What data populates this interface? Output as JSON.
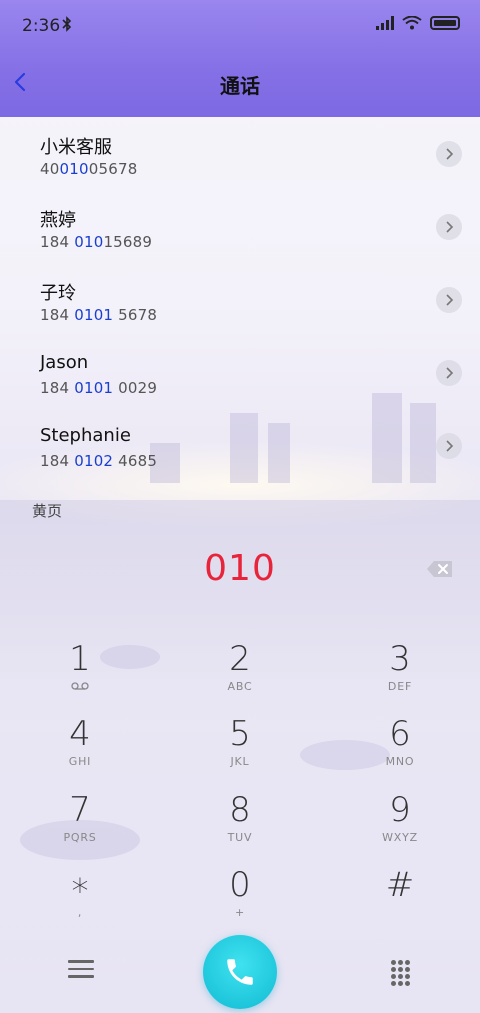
{
  "status": {
    "time": "2:36",
    "bluetooth_icon": "bluetooth-icon"
  },
  "header": {
    "title": "通话"
  },
  "contacts": [
    {
      "name": "小米客服",
      "num_pre": "40",
      "num_hl": "010",
      "num_post": "05678"
    },
    {
      "name": "燕婷",
      "num_pre": "184 ",
      "num_hl": "010",
      "num_post": "15689"
    },
    {
      "name": "子玲",
      "num_pre": "184 ",
      "num_hl": "0101",
      "num_post": " 5678"
    },
    {
      "name": "Jason",
      "num_pre": "184 ",
      "num_hl": "0101",
      "num_post": " 0029"
    },
    {
      "name": "Stephanie",
      "num_pre": "184 ",
      "num_hl": "0102",
      "num_post": " 4685"
    }
  ],
  "section_label": "黄页",
  "dialed": "010",
  "keys": [
    {
      "digit": "1",
      "letters": ""
    },
    {
      "digit": "2",
      "letters": "ABC"
    },
    {
      "digit": "3",
      "letters": "DEF"
    },
    {
      "digit": "4",
      "letters": "GHI"
    },
    {
      "digit": "5",
      "letters": "JKL"
    },
    {
      "digit": "6",
      "letters": "MNO"
    },
    {
      "digit": "7",
      "letters": "PQRS"
    },
    {
      "digit": "8",
      "letters": "TUV"
    },
    {
      "digit": "9",
      "letters": "WXYZ"
    },
    {
      "digit": "∗",
      "letters": ","
    },
    {
      "digit": "0",
      "letters": "+"
    },
    {
      "digit": "#",
      "letters": ""
    }
  ],
  "colors": {
    "accent_blue": "#1a3fd0",
    "dialed_red": "#e8243a",
    "call_cyan": "#1fc7dc",
    "header_purple": "#8570e6"
  }
}
